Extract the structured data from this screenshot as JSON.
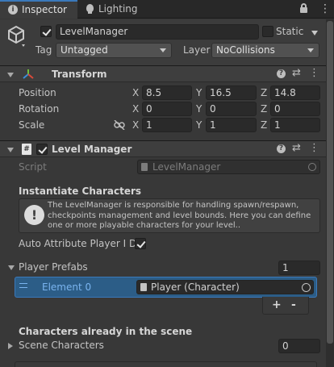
{
  "tabs": [
    {
      "label": "Inspector",
      "icon": "info-icon",
      "active": true
    },
    {
      "label": "Lighting",
      "icon": "lightbulb-icon",
      "active": false
    }
  ],
  "gameobject": {
    "name": "LevelManager",
    "active": true,
    "static_label": "Static",
    "tag_label": "Tag",
    "tag_value": "Untagged",
    "layer_label": "Layer",
    "layer_value": "NoCollisions"
  },
  "transform": {
    "title": "Transform",
    "rows": [
      {
        "label": "Position",
        "x": "8.5",
        "y": "16.5",
        "z": "14.8"
      },
      {
        "label": "Rotation",
        "x": "0",
        "y": "0",
        "z": "0"
      },
      {
        "label": "Scale",
        "x": "1",
        "y": "1",
        "z": "1"
      }
    ],
    "axis_x": "X",
    "axis_y": "Y",
    "axis_z": "Z"
  },
  "level_manager": {
    "title": "Level Manager",
    "enabled": true,
    "script_label": "Script",
    "script_value": "LevelManager",
    "section_instantiate": "Instantiate Characters",
    "help_text": "The LevelManager is responsible for handling spawn/respawn, checkpoints management and level bounds. Here you can define one or more playable characters for your level..",
    "auto_attr_label": "Auto Attribute Player I Ds",
    "auto_attr_checked": true,
    "player_prefabs_label": "Player Prefabs",
    "player_prefabs_count": "1",
    "element_label": "Element 0",
    "element_value": "Player (Character)",
    "plus_label": "+",
    "minus_label": "-",
    "section_scene": "Characters already in the scene",
    "scene_characters_label": "Scene Characters",
    "scene_characters_count": "0"
  },
  "colors": {
    "background": "#383838",
    "selected_row": "#2c5d87",
    "selected_text": "#7ab4ef",
    "field_bg": "#2a2a2a"
  }
}
